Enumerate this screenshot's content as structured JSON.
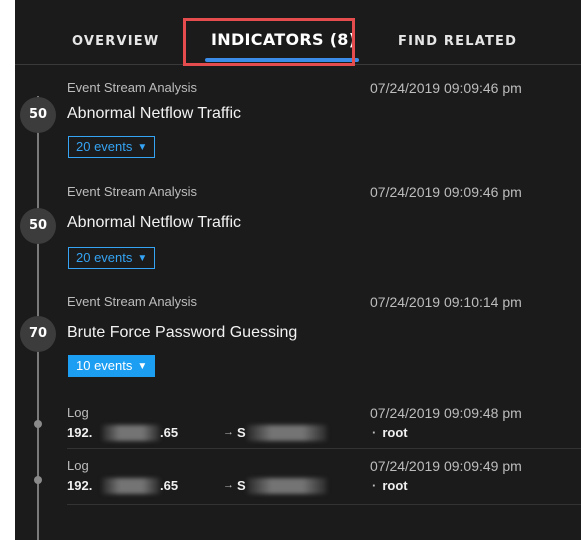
{
  "tabs": {
    "overview": "OVERVIEW",
    "indicators": "INDICATORS (8)",
    "find_related": "FIND RELATED"
  },
  "indicators": [
    {
      "score": "50",
      "source": "Event Stream Analysis",
      "timestamp": "07/24/2019 09:09:46 pm",
      "title": "Abnormal Netflow Traffic",
      "events_label": "20 events"
    },
    {
      "score": "50",
      "source": "Event Stream Analysis",
      "timestamp": "07/24/2019 09:09:46 pm",
      "title": "Abnormal Netflow Traffic",
      "events_label": "20 events"
    },
    {
      "score": "70",
      "source": "Event Stream Analysis",
      "timestamp": "07/24/2019 09:10:14 pm",
      "title": "Brute Force Password Guessing",
      "events_label": "10 events"
    }
  ],
  "logs": [
    {
      "source": "Log",
      "timestamp": "07/24/2019 09:09:48 pm",
      "src_ip_start": "192.",
      "src_ip_end": ".65",
      "arrow": "→",
      "dest_start": "S",
      "user_sep": "·",
      "user": "root"
    },
    {
      "source": "Log",
      "timestamp": "07/24/2019 09:09:49 pm",
      "src_ip_start": "192.",
      "src_ip_end": ".65",
      "arrow": "→",
      "dest_start": "S",
      "user_sep": "·",
      "user": "root"
    }
  ],
  "icons": {
    "chevron": "chevron-down-icon",
    "arrow": "arrow-right-icon"
  },
  "colors": {
    "accent": "#35a4f4",
    "tab_underline": "#3b8be8",
    "highlight": "#e44c4e",
    "background": "#1b1b1b"
  }
}
